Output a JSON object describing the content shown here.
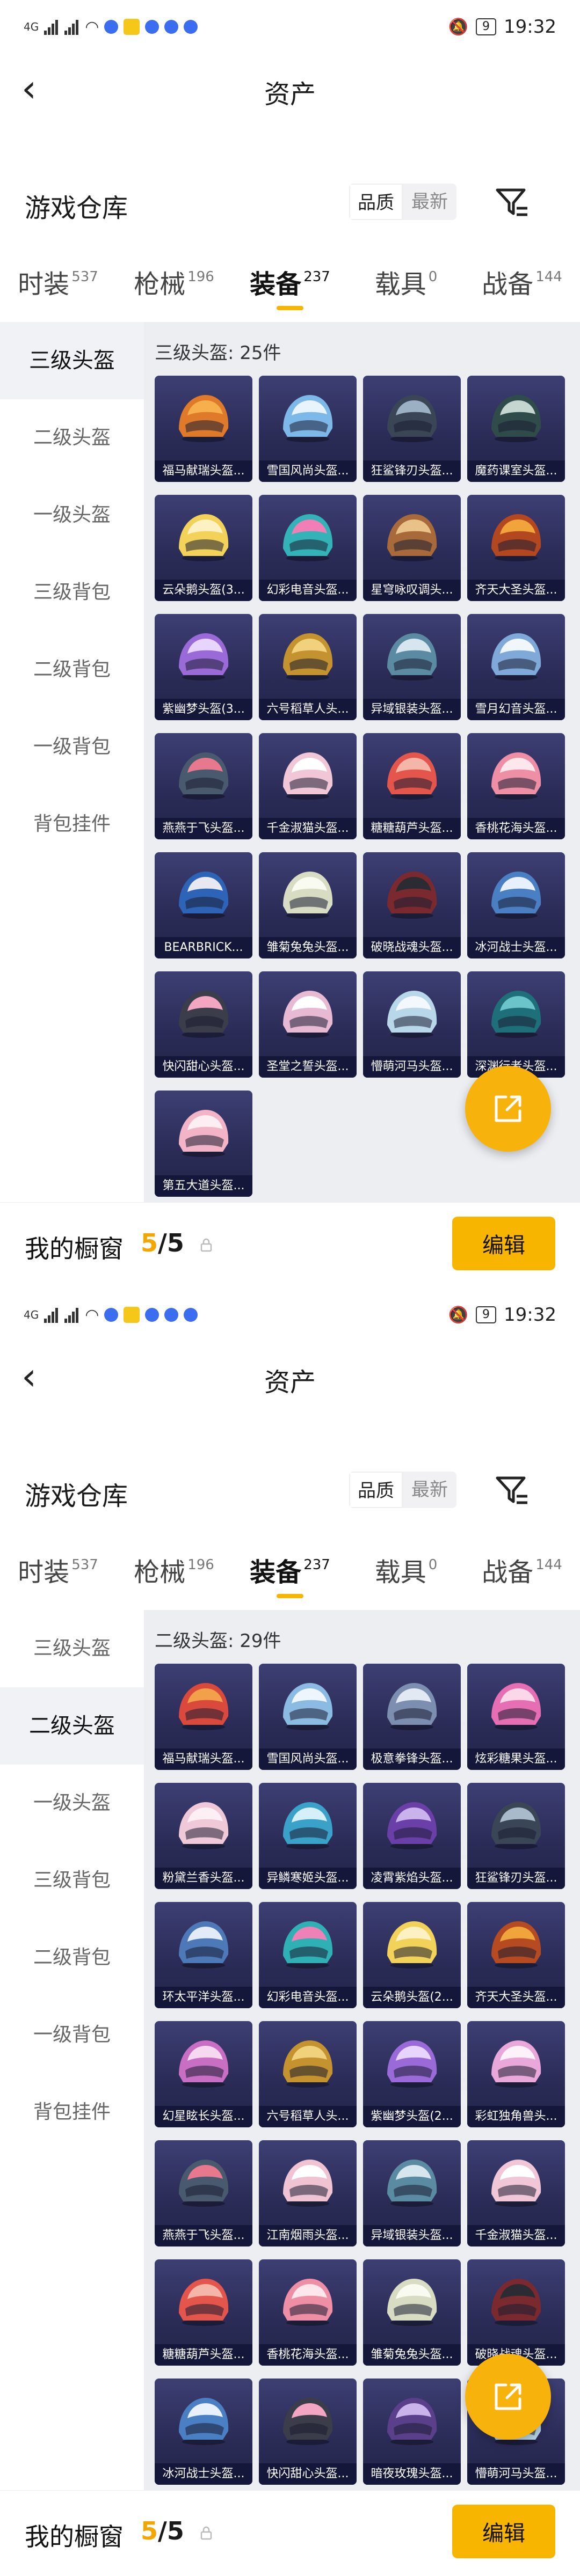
{
  "status_bar": {
    "net": "4G",
    "time": "19:32",
    "battery": "9"
  },
  "header": {
    "back_icon": "chevron-left-icon",
    "title": "资产"
  },
  "warehouse": {
    "title": "游戏仓库",
    "sort_options": [
      "品质",
      "最新"
    ],
    "selected_sort": "品质",
    "filter_icon": "filter-icon"
  },
  "tabs": [
    {
      "label": "时装",
      "count": "537"
    },
    {
      "label": "枪械",
      "count": "196"
    },
    {
      "label": "装备",
      "count": "237"
    },
    {
      "label": "载具",
      "count": "0"
    },
    {
      "label": "战备",
      "count": "144"
    }
  ],
  "active_tab": 2,
  "sidebar": {
    "items": [
      "三级头盔",
      "二级头盔",
      "一级头盔",
      "三级背包",
      "二级背包",
      "一级背包",
      "背包挂件"
    ]
  },
  "screens": [
    {
      "active_side": 0,
      "count_label": "三级头盔: 25件",
      "items": [
        {
          "name": "福马献瑞头盔...",
          "colors": [
            "#e07a2b",
            "#f5b04d"
          ]
        },
        {
          "name": "雪国风尚头盔...",
          "colors": [
            "#7db9e8",
            "#e9f3fb"
          ]
        },
        {
          "name": "狂鲨锋刃头盔...",
          "colors": [
            "#3a4556",
            "#9bb0c3"
          ]
        },
        {
          "name": "魔药课室头盔...",
          "colors": [
            "#2f4c4a",
            "#c4d6cf"
          ]
        },
        {
          "name": "云朵鹅头盔(3...",
          "colors": [
            "#f3d25a",
            "#fbf1c2"
          ]
        },
        {
          "name": "幻彩电音头盔...",
          "colors": [
            "#33b3b8",
            "#f07fb6"
          ]
        },
        {
          "name": "星穹咏叹调头...",
          "colors": [
            "#a86a3a",
            "#e9c28a"
          ]
        },
        {
          "name": "齐天大圣头盔...",
          "colors": [
            "#b3471f",
            "#f0a43a"
          ]
        },
        {
          "name": "紫幽梦头盔(3...",
          "colors": [
            "#9a6bd8",
            "#e7d5ff"
          ]
        },
        {
          "name": "六号稻草人头...",
          "colors": [
            "#c4922e",
            "#f1d27c"
          ]
        },
        {
          "name": "异域银装头盔...",
          "colors": [
            "#5b8ba3",
            "#d7e6ee"
          ]
        },
        {
          "name": "雪月幻音头盔...",
          "colors": [
            "#7fa9d8",
            "#f1f6fb"
          ]
        },
        {
          "name": "燕燕于飞头盔...",
          "colors": [
            "#4a5a6e",
            "#e8788d"
          ]
        },
        {
          "name": "千金淑猫头盔...",
          "colors": [
            "#f1c6d6",
            "#ffffff"
          ]
        },
        {
          "name": "糖糖葫芦头盔...",
          "colors": [
            "#e4554b",
            "#f4b6a9"
          ]
        },
        {
          "name": "香桃花海头盔...",
          "colors": [
            "#ee8fa6",
            "#fde6ec"
          ]
        },
        {
          "name": "BEARBRICK...",
          "colors": [
            "#2e64b8",
            "#e8e8f0"
          ]
        },
        {
          "name": "雏菊兔兔头盔...",
          "colors": [
            "#d8dcc2",
            "#fafbf0"
          ]
        },
        {
          "name": "破晓战魂头盔...",
          "colors": [
            "#7a2a2e",
            "#2b2b33"
          ]
        },
        {
          "name": "冰河战士头盔...",
          "colors": [
            "#4a7fc4",
            "#e8f0fb"
          ]
        },
        {
          "name": "快闪甜心头盔...",
          "colors": [
            "#3b3d4a",
            "#f2a6c2"
          ]
        },
        {
          "name": "圣堂之誓头盔...",
          "colors": [
            "#e7b9d2",
            "#ffffff"
          ]
        },
        {
          "name": "懵萌河马头盔...",
          "colors": [
            "#b8d7e8",
            "#f2f8fb"
          ]
        },
        {
          "name": "深渊行者头盔...",
          "colors": [
            "#1f6f7a",
            "#6bc4c9"
          ]
        },
        {
          "name": "第五大道头盔...",
          "colors": [
            "#f2b4c6",
            "#fdeef3"
          ]
        }
      ]
    },
    {
      "active_side": 1,
      "count_label": "二级头盔: 29件",
      "items": [
        {
          "name": "福马献瑞头盔...",
          "colors": [
            "#d94a3c",
            "#f3a04a"
          ]
        },
        {
          "name": "雪国风尚头盔...",
          "colors": [
            "#8bbbe3",
            "#eef5fb"
          ]
        },
        {
          "name": "极意拳锋头盔...",
          "colors": [
            "#7d8fb0",
            "#e3e9f3"
          ]
        },
        {
          "name": "炫彩糖果头盔...",
          "colors": [
            "#e56fb2",
            "#fbd7ea"
          ]
        },
        {
          "name": "粉黛兰香头盔...",
          "colors": [
            "#f0c9d8",
            "#fdf0f4"
          ]
        },
        {
          "name": "异鳞寒姬头盔...",
          "colors": [
            "#3aa1c9",
            "#d5f0f8"
          ]
        },
        {
          "name": "凌霄紫焰头盔...",
          "colors": [
            "#6a3fa8",
            "#c9b3ea"
          ]
        },
        {
          "name": "狂鲨锋刃头盔...",
          "colors": [
            "#3a4556",
            "#a9bacb"
          ]
        },
        {
          "name": "环太平洋头盔...",
          "colors": [
            "#4d79b8",
            "#e3ebf6"
          ]
        },
        {
          "name": "幻彩电音头盔...",
          "colors": [
            "#2fb0b5",
            "#ee82b7"
          ]
        },
        {
          "name": "云朵鹅头盔(2...",
          "colors": [
            "#f3d25a",
            "#fbf1c2"
          ]
        },
        {
          "name": "齐天大圣头盔...",
          "colors": [
            "#b64a20",
            "#f0a53c"
          ]
        },
        {
          "name": "幻星眩长头盔...",
          "colors": [
            "#c86fc4",
            "#f6d8f1"
          ]
        },
        {
          "name": "六号稻草人头...",
          "colors": [
            "#c4922e",
            "#f1d27c"
          ]
        },
        {
          "name": "紫幽梦头盔(2...",
          "colors": [
            "#9a6bd8",
            "#e7d5ff"
          ]
        },
        {
          "name": "彩虹独角兽头...",
          "colors": [
            "#e9a8d9",
            "#fdf1fa"
          ]
        },
        {
          "name": "燕燕于飞头盔...",
          "colors": [
            "#4a5a6e",
            "#e8788d"
          ]
        },
        {
          "name": "江南烟雨头盔...",
          "colors": [
            "#f0c3d2",
            "#ffffff"
          ]
        },
        {
          "name": "异域银装头盔...",
          "colors": [
            "#5b8ba3",
            "#d7e6ee"
          ]
        },
        {
          "name": "千金淑猫头盔...",
          "colors": [
            "#f1c6d6",
            "#ffffff"
          ]
        },
        {
          "name": "糖糖葫芦头盔...",
          "colors": [
            "#e4554b",
            "#f4b6a9"
          ]
        },
        {
          "name": "香桃花海头盔...",
          "colors": [
            "#ee8fa6",
            "#fde6ec"
          ]
        },
        {
          "name": "雏菊兔兔头盔...",
          "colors": [
            "#d8dcc2",
            "#fafbf0"
          ]
        },
        {
          "name": "破晓战魂头盔...",
          "colors": [
            "#7a2a2e",
            "#2b2b33"
          ]
        },
        {
          "name": "冰河战士头盔...",
          "colors": [
            "#4a7fc4",
            "#e8f0fb"
          ]
        },
        {
          "name": "快闪甜心头盔...",
          "colors": [
            "#3b3d4a",
            "#f2a6c2"
          ]
        },
        {
          "name": "暗夜玫瑰头盔...",
          "colors": [
            "#5a3f8a",
            "#c9b3ea"
          ]
        },
        {
          "name": "懵萌河马头盔...",
          "colors": [
            "#b8d7e8",
            "#f2f8fb"
          ]
        }
      ]
    }
  ],
  "bottom_bar": {
    "label": "我的橱窗",
    "used": "5",
    "separator": "/",
    "total": "5",
    "lock_icon": "lock-icon",
    "edit_label": "编辑"
  },
  "fab_icon": "share-external-icon",
  "colors": {
    "accent": "#f7b500",
    "card_bg": "#2e2f5e",
    "content_bg": "#eceef2",
    "sidebar_active_bg": "#f1f2f5"
  }
}
